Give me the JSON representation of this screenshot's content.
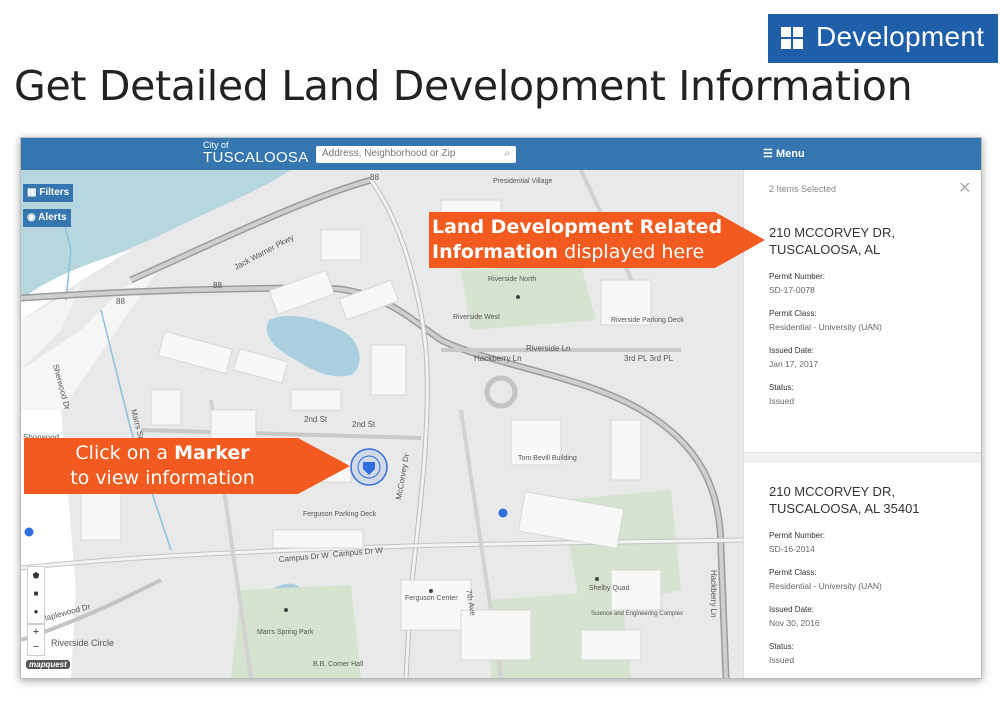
{
  "badge": {
    "icon": "grid-icon",
    "label": "Development"
  },
  "headline": "Get Detailed Land Development Information",
  "app": {
    "logo_line1": "City of",
    "logo_line2": "TUSCALOOSA",
    "search_placeholder": "Address, Neighborhood or Zip",
    "menu_label": "Menu"
  },
  "map": {
    "filters_label": "Filters",
    "alerts_label": "Alerts",
    "zoom_in": "+",
    "zoom_out": "−",
    "attribution": "mapquest",
    "labels": {
      "jack_warner": "Jack Warner Pkwy",
      "hwy88a": "88",
      "hwy88b": "88",
      "hwy88c": "88",
      "presidential": "Presidential Village",
      "riverside_north": "Riverside North",
      "riverside_west": "Riverside West",
      "riverside_parking": "Riverside Parking Deck",
      "riverside_ln": "Riverside Ln",
      "hackberry_ln": "Hackberry Ln",
      "third_pl": "3rd PL 3rd PL",
      "second_st": "2nd St",
      "second_st2": "2nd St",
      "mccorvey": "McCorvey Dr",
      "marrs_spring": "Marrs Spring Rd",
      "sherwood": "Sherwood Dr",
      "shorwood": "Shorwood",
      "tom_bevill": "Tom Bevill Building",
      "ferguson_parking": "Ferguson Parking Deck",
      "campus_dr": "Campus Dr W",
      "campus_dr2": "Campus Dr W",
      "seventh_ave": "7th Ave",
      "ferguson_center": "Ferguson Center",
      "shelby_quad": "Shelby Quad",
      "science_complex": "Science and Engineering Complex",
      "marrs_park": "Marrs Spring Park",
      "bb_comer": "B.B. Comer Hall",
      "riverside_circle": "Riverside Circle",
      "maplewood": "Maplewood Dr",
      "hackberry_ln3": "Hackberry Ln"
    }
  },
  "panel": {
    "items_selected": "2 Items Selected",
    "records": [
      {
        "address": "210 MCCORVEY DR, TUSCALOOSA, AL",
        "permit_number_label": "Permit Number:",
        "permit_number": "SD-17-0078",
        "permit_class_label": "Permit Class:",
        "permit_class": "Residential - University (UAN)",
        "issued_date_label": "Issued Date:",
        "issued_date": "Jan 17, 2017",
        "status_label": "Status:",
        "status": "Issued"
      },
      {
        "address": "210 MCCORVEY DR, TUSCALOOSA, AL 35401",
        "permit_number_label": "Permit Number:",
        "permit_number": "SD-16-2014",
        "permit_class_label": "Permit Class:",
        "permit_class": "Residential - University (UAN)",
        "issued_date_label": "Issued Date:",
        "issued_date": "Nov 30, 2016",
        "status_label": "Status:",
        "status": "Issued"
      }
    ]
  },
  "callouts": {
    "info_bold": "Land Development Related",
    "info_bold2": "Information",
    "info_rest": " displayed here",
    "marker_line1": "Click on a ",
    "marker_bold": "Marker",
    "marker_line2": "to view information"
  },
  "colors": {
    "brand_blue": "#1f5ea8",
    "header_blue": "#3575b0",
    "callout_orange": "#f35a1f",
    "marker_blue": "#2f6fdc"
  }
}
